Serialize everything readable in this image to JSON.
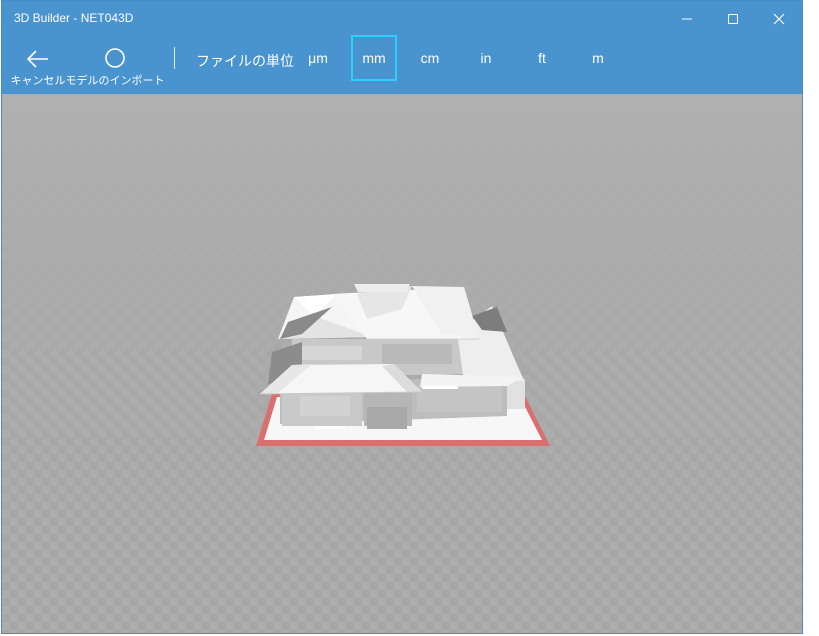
{
  "window": {
    "title": "3D Builder - NET043D"
  },
  "toolbar": {
    "cancel_label": "キャンセル",
    "import_label": "モデルのインポート",
    "units_label": "ファイルの単位",
    "units": [
      "μm",
      "mm",
      "cm",
      "in",
      "ft",
      "m"
    ],
    "selected_unit": "mm"
  },
  "icons": {
    "cancel": "arrow-left-icon",
    "import": "circle-icon",
    "minimize": "minimize-icon",
    "maximize": "maximize-icon",
    "close": "close-icon"
  },
  "colors": {
    "accent": "#4993cf",
    "selection": "#2ad0ff",
    "viewport": "#a9a9a9",
    "base_outline": "#d9706f"
  }
}
